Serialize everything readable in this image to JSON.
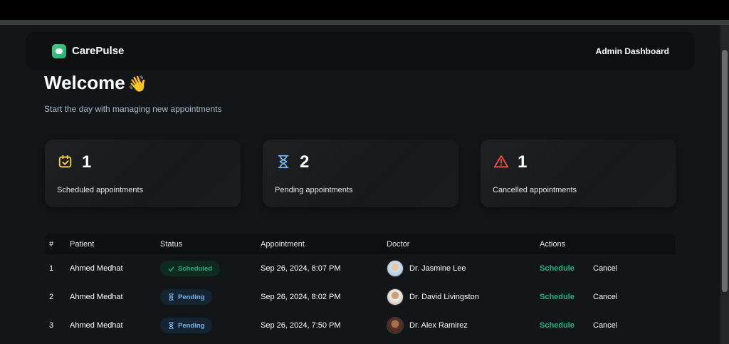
{
  "app": {
    "brand": "CarePulse",
    "admin_label": "Admin Dashboard"
  },
  "welcome": {
    "title": "Welcome",
    "emoji": "👋",
    "subtitle": "Start the day with managing new appointments"
  },
  "stats": [
    {
      "count": "1",
      "label": "Scheduled appointments",
      "icon": "calendar-icon",
      "color": "#ffd147"
    },
    {
      "count": "2",
      "label": "Pending appointments",
      "icon": "hourglass-icon",
      "color": "#79b5ec"
    },
    {
      "count": "1",
      "label": "Cancelled appointments",
      "icon": "alert-triangle-icon",
      "color": "#f24e43"
    }
  ],
  "table": {
    "headers": [
      "#",
      "Patient",
      "Status",
      "Appointment",
      "Doctor",
      "Actions"
    ],
    "rows": [
      {
        "num": "1",
        "patient": "Ahmed Medhat",
        "status": "Scheduled",
        "appointment": "Sep 26, 2024, 8:07 PM",
        "doctor": "Dr. Jasmine Lee",
        "schedule": "Schedule",
        "cancel": "Cancel"
      },
      {
        "num": "2",
        "patient": "Ahmed Medhat",
        "status": "Pending",
        "appointment": "Sep 26, 2024, 8:02 PM",
        "doctor": "Dr. David Livingston",
        "schedule": "Schedule",
        "cancel": "Cancel"
      },
      {
        "num": "3",
        "patient": "Ahmed Medhat",
        "status": "Pending",
        "appointment": "Sep 26, 2024, 7:50 PM",
        "doctor": "Dr. Alex Ramirez",
        "schedule": "Schedule",
        "cancel": "Cancel"
      }
    ]
  },
  "colors": {
    "accent_green": "#24ae7c",
    "pending_blue": "#79b5ec",
    "warning_yellow": "#ffd147",
    "danger_red": "#f24e43",
    "background": "#131619"
  }
}
